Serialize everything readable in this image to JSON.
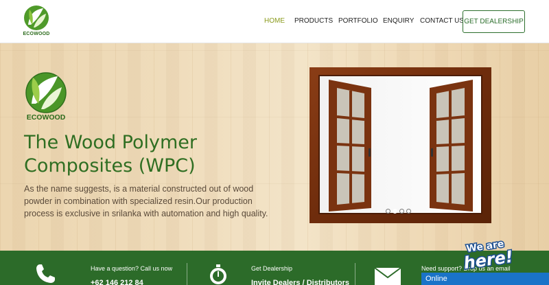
{
  "header": {
    "logo_text": "ECOWOOD",
    "nav": [
      {
        "label": "HOME",
        "active": true
      },
      {
        "label": "PRODUCTS",
        "active": false
      },
      {
        "label": "PORTFOLIO",
        "active": false
      },
      {
        "label": "ENQUIRY",
        "active": false
      },
      {
        "label": "CONTACT US",
        "active": false
      }
    ],
    "cta_label": "GET DEALERSHIP"
  },
  "hero": {
    "logo_text": "ECOWOOD",
    "title_line1": "The Wood Polymer",
    "title_line2": "Composites (WPC)",
    "description": "As the name suggests, is a material constructed out of wood powder in combination with specialized resin.Our production process is exclusive in srilanka with automation and high quality.",
    "slider": {
      "count": 4,
      "active_index": 1
    }
  },
  "footer": {
    "call_label": "Have a question? Call us now",
    "call_value": "+62 146 212 84",
    "dealer_label": "Get Dealership",
    "dealer_value": "Invite Dealers / Distributors",
    "support_label": "Need support? Drop us an email"
  },
  "chat": {
    "badge_line1": "We are",
    "badge_line2": "here!",
    "status": "Online"
  },
  "colors": {
    "brand_green": "#2c6b29",
    "nav_active": "#8a9a1c",
    "chat_blue": "#1a73c8"
  }
}
